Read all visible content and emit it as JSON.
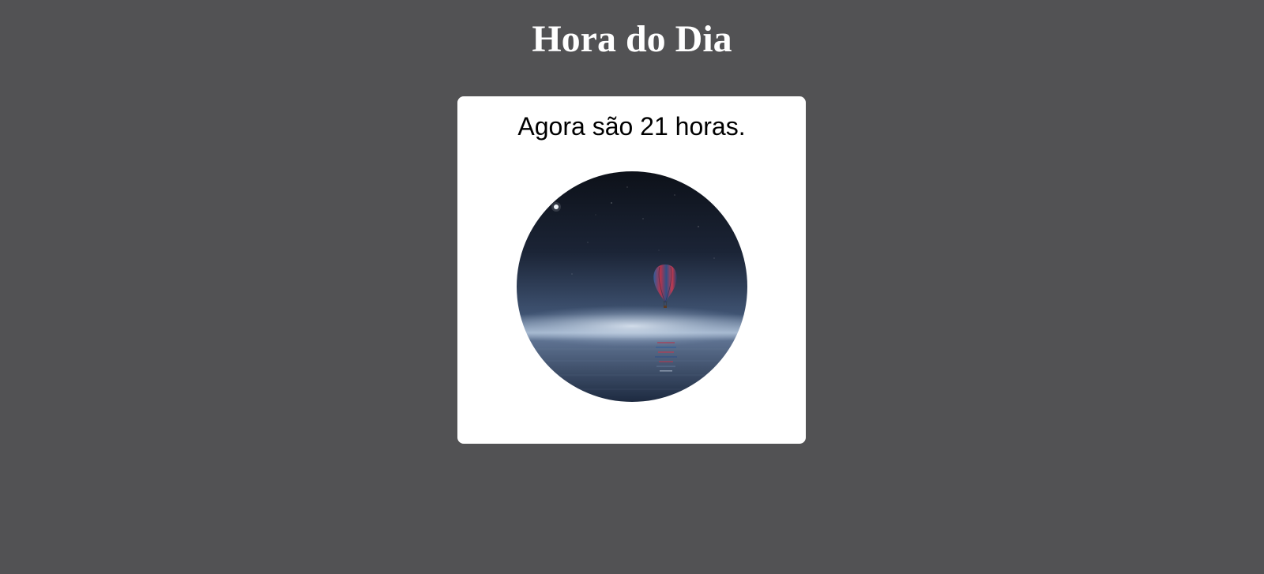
{
  "page": {
    "title": "Hora do Dia",
    "background_color": "#525254"
  },
  "card": {
    "message": "Agora são 21 horas.",
    "background_color": "#ffffff",
    "image": {
      "icon": "night-sea-balloon-image",
      "description_colors": {
        "sky_top": "#0d1119",
        "sky_mid": "#2b3a52",
        "horizon_glow": "#c9d6e6",
        "water": "#2a3a55",
        "balloon_red": "#b5344a",
        "balloon_blue": "#2f5c9a"
      }
    }
  }
}
